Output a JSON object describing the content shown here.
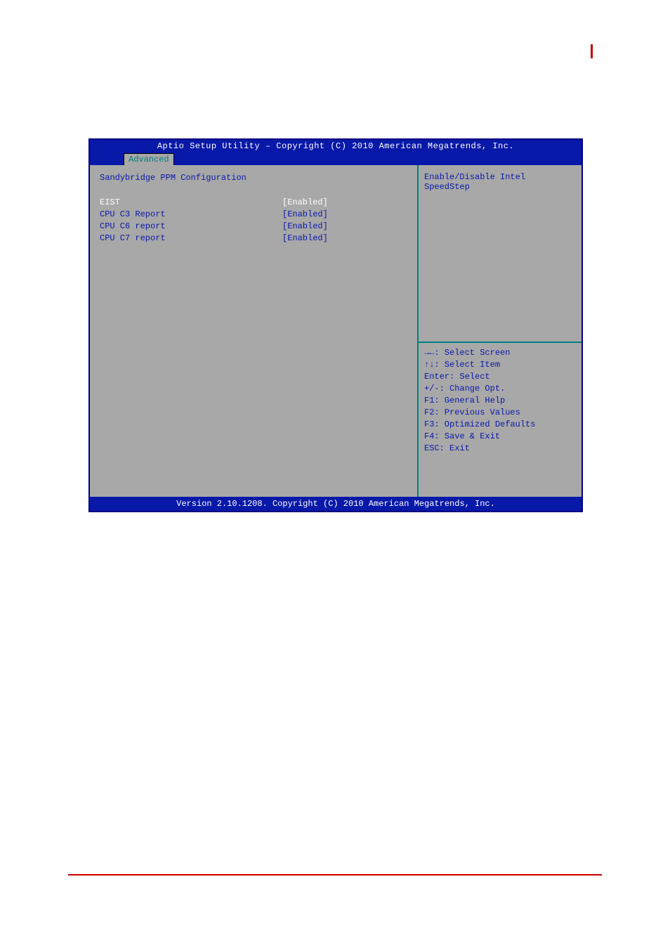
{
  "bios": {
    "title": "Aptio Setup Utility – Copyright (C) 2010 American Megatrends, Inc.",
    "active_tab": "Advanced",
    "section_title": "Sandybridge PPM Configuration",
    "settings": [
      {
        "label": "EIST",
        "value": "[Enabled]",
        "selected": true
      },
      {
        "label": "CPU C3 Report",
        "value": "[Enabled]",
        "selected": false
      },
      {
        "label": "CPU C6 report",
        "value": "[Enabled]",
        "selected": false
      },
      {
        "label": "CPU C7 report",
        "value": "[Enabled]",
        "selected": false
      }
    ],
    "help_text": "Enable/Disable Intel SpeedStep",
    "keys": [
      "→←: Select Screen",
      "↑↓: Select Item",
      "Enter: Select",
      "+/-: Change Opt.",
      "F1: General Help",
      "F2: Previous Values",
      "F3: Optimized Defaults",
      "F4: Save & Exit",
      "ESC: Exit"
    ],
    "footer": "Version 2.10.1208. Copyright (C) 2010 American Megatrends, Inc."
  }
}
